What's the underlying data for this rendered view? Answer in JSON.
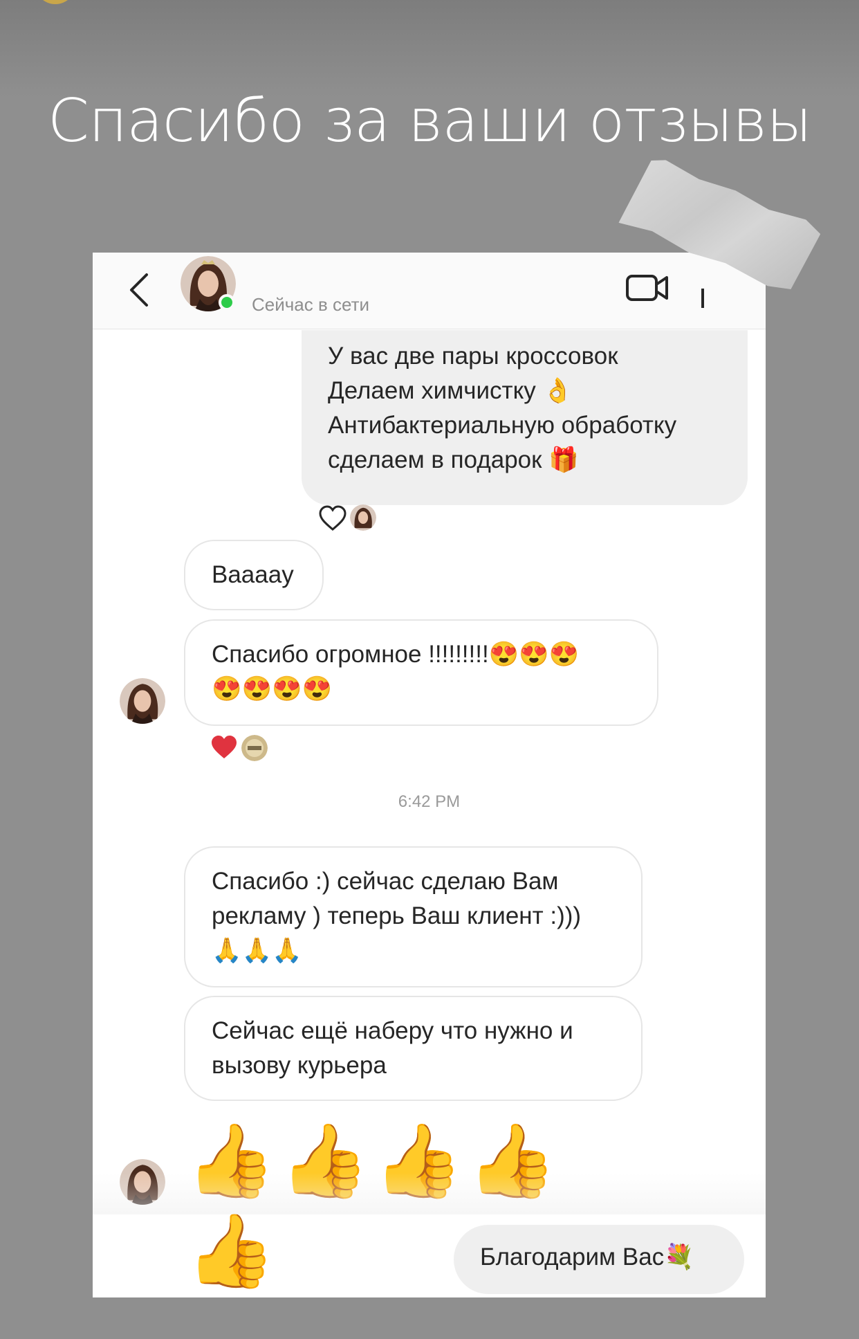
{
  "story": {
    "title": "Спасибо за ваши отзывы"
  },
  "header": {
    "status": "Сейчас в сети"
  },
  "messages": {
    "outgoing_1": "У вас две пары кроссовок\nДелаем химчистку 👌\nАнтибактериальную обработку\nсделаем в подарок 🎁",
    "incoming_1": "Вааааy",
    "incoming_2": "Спасибо огромное !!!!!!!!!😍😍😍\n😍😍😍😍",
    "timestamp": "6:42 PM",
    "incoming_3": "Спасибо :) сейчас сделаю Вам\nрекламу ) теперь Ваш клиент :)))\n🙏🙏🙏",
    "incoming_4": "Сейчас ещё наберу что нужно и\nвызову курьера",
    "incoming_5": "👍👍👍👍👍",
    "outgoing_2": "Благодарим Вас💐"
  },
  "reactions": {
    "outgoing_1": "heart-outline-icon",
    "incoming_2": "heart-filled-icon"
  },
  "colors": {
    "background": "#8f8f8f",
    "online": "#2ecc4a",
    "heart": "#e0333f",
    "bubble_outgoing": "#efefef"
  }
}
